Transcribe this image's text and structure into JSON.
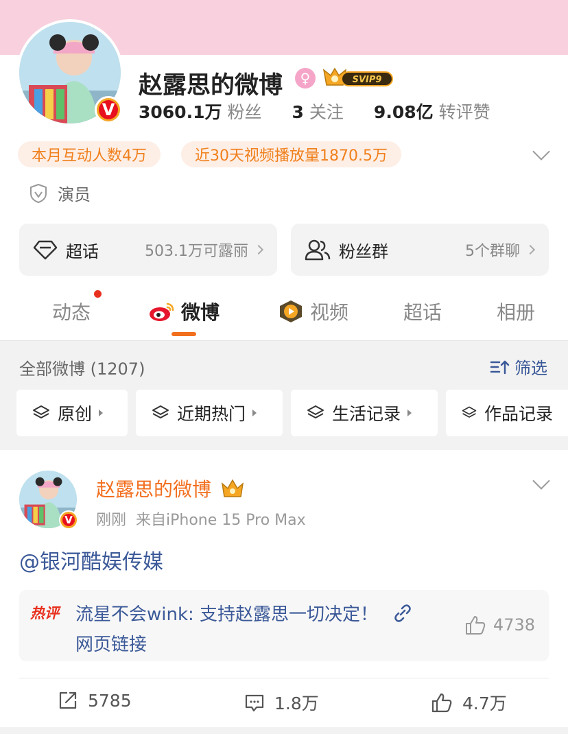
{
  "profile": {
    "name": "赵露思的微博",
    "svip_label": "SVIP9",
    "verified_badge": "V",
    "stats": [
      {
        "value": "3060.1万",
        "label": "粉丝"
      },
      {
        "value": "3",
        "label": "关注"
      },
      {
        "value": "9.08亿",
        "label": "转评赞"
      }
    ],
    "pills": [
      "本月互动人数4万",
      "近30天视频播放量1870.5万"
    ],
    "verification": "演员",
    "super_topic": {
      "title": "超话",
      "subtitle": "503.1万可露丽"
    },
    "fan_group": {
      "title": "粉丝群",
      "subtitle": "5个群聊"
    }
  },
  "tabs": [
    {
      "label": "动态"
    },
    {
      "label": "微博"
    },
    {
      "label": "视频"
    },
    {
      "label": "超话"
    },
    {
      "label": "相册"
    }
  ],
  "feed_filter": {
    "all_label": "全部微博 (1207)",
    "filter_label": "筛选",
    "chips": [
      "原创",
      "近期热门",
      "生活记录",
      "作品记录"
    ]
  },
  "post": {
    "author": "赵露思的微博",
    "time": "刚刚",
    "source": "来自iPhone 15 Pro Max",
    "text": "@银河酷娱传媒",
    "hot_comment": {
      "tag": "热评",
      "text": "流星不会wink: 支持赵露思一切决定！",
      "link_text": "网页链接",
      "likes": "4738"
    },
    "actions": {
      "repost": "5785",
      "comment": "1.8万",
      "like": "4.7万"
    }
  },
  "colors": {
    "accent": "#f26f1f",
    "link": "#3b5998",
    "banner": "#f8d0de",
    "vip_gold": "#f5a623"
  }
}
